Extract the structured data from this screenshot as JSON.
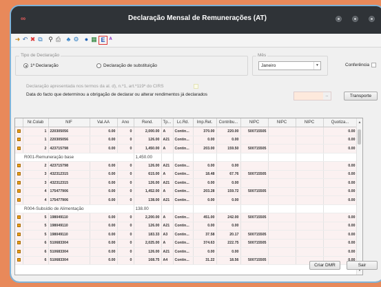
{
  "window": {
    "title": "Declaração Mensal de Remunerações (AT)"
  },
  "toolbar": {
    "icons": [
      "open-icon",
      "undo-icon",
      "delete-x-icon",
      "copy-icon",
      "binoculars-icon",
      "print-icon",
      "wizard-icon",
      "settings-icon",
      "info-icon",
      "export-excel-icon",
      "export-e-icon",
      "spell-icon"
    ]
  },
  "tipo": {
    "legend": "Tipo de Declaração",
    "opt1": "1ª Declaração",
    "opt2": "Declaração de substituição"
  },
  "mes": {
    "legend": "Mês",
    "value": "Janeiro"
  },
  "conferencia": {
    "label": "Conferência"
  },
  "info": {
    "line1": "Declaração apresentada nos termos da al. d), n.º1, art.º119º do CIRS",
    "line2": "Data do facto que determinou a obrigação de declarar ou alterar rendimentos já declarados"
  },
  "buttons": {
    "date_picker": "...",
    "transporte": "Transporte",
    "criar_dmr": "Criar DMR",
    "sair": "Sair"
  },
  "table": {
    "headers": [
      "Nr.Colab",
      "NIF",
      "Val.AA",
      "Ano",
      "Rend.",
      "Tp...",
      "Lc.Rd.",
      "Imp.Ret.",
      "Contribu...",
      "NIPC",
      "NIPC",
      "NIPC",
      "Quotiza..."
    ],
    "rows": [
      {
        "type": "data",
        "nr": "1",
        "nif": "220305056",
        "val": "0.00",
        "ano": "0",
        "rend": "2,000.00",
        "tp": "A",
        "lc": "Contin...",
        "imp": "370.00",
        "contr": "220.00",
        "nipc": "500715505",
        "quot": "0.00"
      },
      {
        "type": "data",
        "nr": "1",
        "nif": "220305056",
        "val": "0.00",
        "ano": "0",
        "rend": "126.00",
        "tp": "A21",
        "lc": "Contin...",
        "imp": "0.00",
        "contr": "0.00",
        "nipc": "",
        "quot": "0.00"
      },
      {
        "type": "data",
        "nr": "2",
        "nif": "423715798",
        "val": "0.00",
        "ano": "0",
        "rend": "1,450.00",
        "tp": "A",
        "lc": "Contin...",
        "imp": "203.00",
        "contr": "159.50",
        "nipc": "500715505",
        "quot": "0.00"
      },
      {
        "type": "sub",
        "label": "R001-Remuneração base",
        "value": "1,450.00"
      },
      {
        "type": "data",
        "nr": "2",
        "nif": "423715798",
        "val": "0.00",
        "ano": "0",
        "rend": "126.00",
        "tp": "A21",
        "lc": "Contin...",
        "imp": "0.00",
        "contr": "0.00",
        "nipc": "",
        "quot": "0.00"
      },
      {
        "type": "data",
        "nr": "3",
        "nif": "432312315",
        "val": "0.00",
        "ano": "0",
        "rend": "615.00",
        "tp": "A",
        "lc": "Contin...",
        "imp": "18.48",
        "contr": "67.76",
        "nipc": "500715505",
        "quot": "0.00"
      },
      {
        "type": "data",
        "nr": "3",
        "nif": "432312315",
        "val": "0.00",
        "ano": "0",
        "rend": "126.00",
        "tp": "A21",
        "lc": "Contin...",
        "imp": "0.00",
        "contr": "0.00",
        "nipc": "",
        "quot": "0.00"
      },
      {
        "type": "data",
        "nr": "4",
        "nif": "175477906",
        "val": "0.00",
        "ano": "0",
        "rend": "1,452.00",
        "tp": "A",
        "lc": "Contin...",
        "imp": "203.28",
        "contr": "159.72",
        "nipc": "500715505",
        "quot": "0.00"
      },
      {
        "type": "data",
        "nr": "4",
        "nif": "175477906",
        "val": "0.00",
        "ano": "0",
        "rend": "138.00",
        "tp": "A21",
        "lc": "Contin...",
        "imp": "0.00",
        "contr": "0.00",
        "nipc": "",
        "quot": "0.00"
      },
      {
        "type": "sub",
        "label": "R004-Subsídio de Alimentação",
        "value": "138.00"
      },
      {
        "type": "data",
        "nr": "5",
        "nif": "198049110",
        "val": "0.00",
        "ano": "0",
        "rend": "2,200.00",
        "tp": "A",
        "lc": "Contin...",
        "imp": "451.00",
        "contr": "242.00",
        "nipc": "500715505",
        "quot": "0.00"
      },
      {
        "type": "data",
        "nr": "5",
        "nif": "198049110",
        "val": "0.00",
        "ano": "0",
        "rend": "126.00",
        "tp": "A21",
        "lc": "Contin...",
        "imp": "0.00",
        "contr": "0.00",
        "nipc": "",
        "quot": "0.00"
      },
      {
        "type": "data",
        "nr": "5",
        "nif": "198049110",
        "val": "0.00",
        "ano": "0",
        "rend": "183.33",
        "tp": "A3",
        "lc": "Contin...",
        "imp": "37.58",
        "contr": "20.17",
        "nipc": "500715505",
        "quot": "0.00"
      },
      {
        "type": "data",
        "nr": "6",
        "nif": "510683304",
        "val": "0.00",
        "ano": "0",
        "rend": "2,025.00",
        "tp": "A",
        "lc": "Contin...",
        "imp": "374.63",
        "contr": "222.75",
        "nipc": "500715505",
        "quot": "0.00"
      },
      {
        "type": "data",
        "nr": "6",
        "nif": "510683304",
        "val": "0.00",
        "ano": "0",
        "rend": "126.00",
        "tp": "A21",
        "lc": "Contin...",
        "imp": "0.00",
        "contr": "0.00",
        "nipc": "",
        "quot": "0.00"
      },
      {
        "type": "data",
        "nr": "6",
        "nif": "510683304",
        "val": "0.00",
        "ano": "0",
        "rend": "168.75",
        "tp": "A4",
        "lc": "Contin...",
        "imp": "31.22",
        "contr": "18.56",
        "nipc": "500715505",
        "quot": "0.00"
      }
    ]
  }
}
